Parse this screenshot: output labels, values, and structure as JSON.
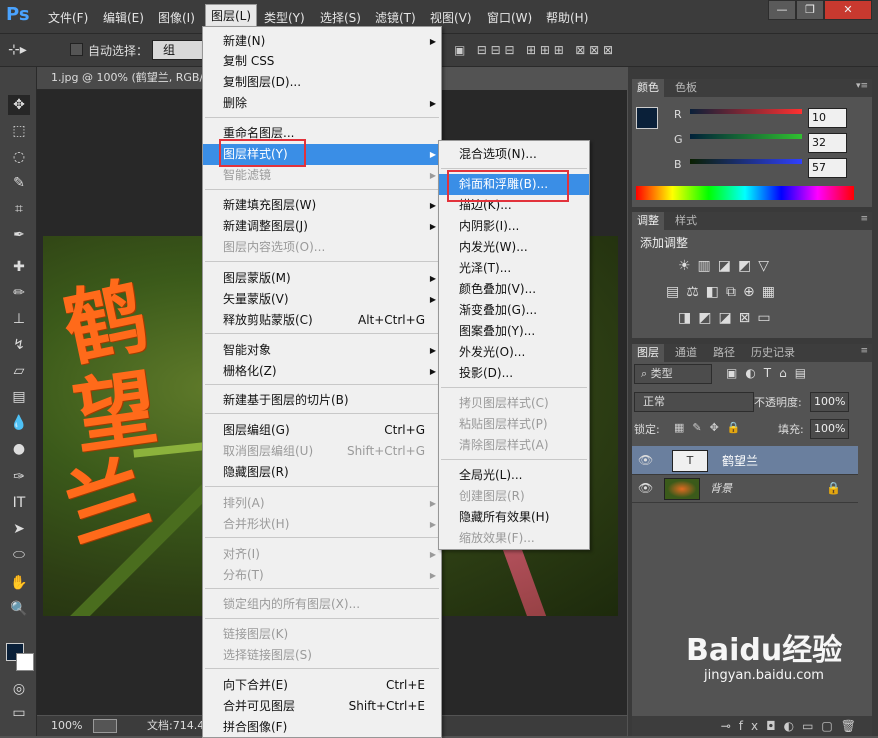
{
  "app": {
    "logo": "Ps"
  },
  "menubar": {
    "items": [
      "文件(F)",
      "编辑(E)",
      "图像(I)",
      "图层(L)",
      "类型(Y)",
      "选择(S)",
      "滤镜(T)",
      "视图(V)",
      "窗口(W)",
      "帮助(H)"
    ],
    "active": "图层(L)"
  },
  "window_controls": {
    "minimize": "—",
    "restore": "❐",
    "close": "✕"
  },
  "options": {
    "auto_select_label": "自动选择：",
    "auto_select_value": "组"
  },
  "document": {
    "tab_title": "1.jpg @ 100% (鹤望兰, RGB/",
    "zoom": "100%",
    "doc_info": "文档:714.4"
  },
  "layer_menu": {
    "items": [
      {
        "label": "新建(N)",
        "shortcut": "",
        "submenu": true,
        "disabled": false
      },
      {
        "label": "复制 CSS",
        "shortcut": "",
        "submenu": false,
        "disabled": false
      },
      {
        "label": "复制图层(D)...",
        "shortcut": "",
        "submenu": false,
        "disabled": false
      },
      {
        "label": "删除",
        "shortcut": "",
        "submenu": true,
        "disabled": false
      },
      {
        "label": "重命名图层...",
        "shortcut": "",
        "submenu": false,
        "disabled": false
      },
      {
        "label": "图层样式(Y)",
        "shortcut": "",
        "submenu": true,
        "disabled": false,
        "highlighted": true
      },
      {
        "label": "智能滤镜",
        "shortcut": "",
        "submenu": true,
        "disabled": true
      },
      {
        "label": "新建填充图层(W)",
        "shortcut": "",
        "submenu": true,
        "disabled": false
      },
      {
        "label": "新建调整图层(J)",
        "shortcut": "",
        "submenu": true,
        "disabled": false
      },
      {
        "label": "图层内容选项(O)...",
        "shortcut": "",
        "submenu": false,
        "disabled": true
      },
      {
        "label": "图层蒙版(M)",
        "shortcut": "",
        "submenu": true,
        "disabled": false
      },
      {
        "label": "矢量蒙版(V)",
        "shortcut": "",
        "submenu": true,
        "disabled": false
      },
      {
        "label": "释放剪贴蒙版(C)",
        "shortcut": "Alt+Ctrl+G",
        "submenu": false,
        "disabled": false
      },
      {
        "label": "智能对象",
        "shortcut": "",
        "submenu": true,
        "disabled": false
      },
      {
        "label": "栅格化(Z)",
        "shortcut": "",
        "submenu": true,
        "disabled": false
      },
      {
        "label": "新建基于图层的切片(B)",
        "shortcut": "",
        "submenu": false,
        "disabled": false
      },
      {
        "label": "图层编组(G)",
        "shortcut": "Ctrl+G",
        "submenu": false,
        "disabled": false
      },
      {
        "label": "取消图层编组(U)",
        "shortcut": "Shift+Ctrl+G",
        "submenu": false,
        "disabled": true
      },
      {
        "label": "隐藏图层(R)",
        "shortcut": "",
        "submenu": false,
        "disabled": false
      },
      {
        "label": "排列(A)",
        "shortcut": "",
        "submenu": true,
        "disabled": true
      },
      {
        "label": "合并形状(H)",
        "shortcut": "",
        "submenu": true,
        "disabled": true
      },
      {
        "label": "对齐(I)",
        "shortcut": "",
        "submenu": true,
        "disabled": true
      },
      {
        "label": "分布(T)",
        "shortcut": "",
        "submenu": true,
        "disabled": true
      },
      {
        "label": "锁定组内的所有图层(X)...",
        "shortcut": "",
        "submenu": false,
        "disabled": true
      },
      {
        "label": "链接图层(K)",
        "shortcut": "",
        "submenu": false,
        "disabled": true
      },
      {
        "label": "选择链接图层(S)",
        "shortcut": "",
        "submenu": false,
        "disabled": true
      },
      {
        "label": "向下合并(E)",
        "shortcut": "Ctrl+E",
        "submenu": false,
        "disabled": false
      },
      {
        "label": "合并可见图层",
        "shortcut": "Shift+Ctrl+E",
        "submenu": false,
        "disabled": false
      },
      {
        "label": "拼合图像(F)",
        "shortcut": "",
        "submenu": false,
        "disabled": false
      }
    ]
  },
  "style_submenu": {
    "items": [
      {
        "label": "混合选项(N)...",
        "disabled": false
      },
      {
        "label": "斜面和浮雕(B)...",
        "disabled": false,
        "highlighted": true
      },
      {
        "label": "描边(K)...",
        "disabled": false
      },
      {
        "label": "内阴影(I)...",
        "disabled": false
      },
      {
        "label": "内发光(W)...",
        "disabled": false
      },
      {
        "label": "光泽(T)...",
        "disabled": false
      },
      {
        "label": "颜色叠加(V)...",
        "disabled": false
      },
      {
        "label": "渐变叠加(G)...",
        "disabled": false
      },
      {
        "label": "图案叠加(Y)...",
        "disabled": false
      },
      {
        "label": "外发光(O)...",
        "disabled": false
      },
      {
        "label": "投影(D)...",
        "disabled": false
      },
      {
        "label": "拷贝图层样式(C)",
        "disabled": true
      },
      {
        "label": "粘贴图层样式(P)",
        "disabled": true
      },
      {
        "label": "清除图层样式(A)",
        "disabled": true
      },
      {
        "label": "全局光(L)...",
        "disabled": false
      },
      {
        "label": "创建图层(R)",
        "disabled": true
      },
      {
        "label": "隐藏所有效果(H)",
        "disabled": false
      },
      {
        "label": "缩放效果(F)...",
        "disabled": true
      }
    ]
  },
  "color_panel": {
    "tabs": [
      "颜色",
      "色板"
    ],
    "channels": [
      {
        "name": "R",
        "value": "10",
        "color": "#ff3030"
      },
      {
        "name": "G",
        "value": "32",
        "color": "#30c030"
      },
      {
        "name": "B",
        "value": "57",
        "color": "#3040ff"
      }
    ],
    "foreground": "#0a2039"
  },
  "adjust_panel": {
    "tabs": [
      "调整",
      "样式"
    ],
    "title": "添加调整"
  },
  "layers_panel": {
    "tabs": [
      "图层",
      "通道",
      "路径",
      "历史记录"
    ],
    "filter_label": "类型",
    "blend_mode": "正常",
    "opacity_label": "不透明度:",
    "opacity_value": "100%",
    "lock_label": "锁定:",
    "fill_label": "填充:",
    "fill_value": "100%",
    "layers": [
      {
        "name": "鹤望兰",
        "type": "text",
        "selected": true
      },
      {
        "name": "背景",
        "type": "image",
        "selected": false,
        "locked": true
      }
    ]
  },
  "canvas_text": {
    "line1": "鹤",
    "line2": "望",
    "line3": "兰"
  },
  "watermark": {
    "brand": "Baidu经验",
    "url": "jingyan.baidu.com"
  }
}
